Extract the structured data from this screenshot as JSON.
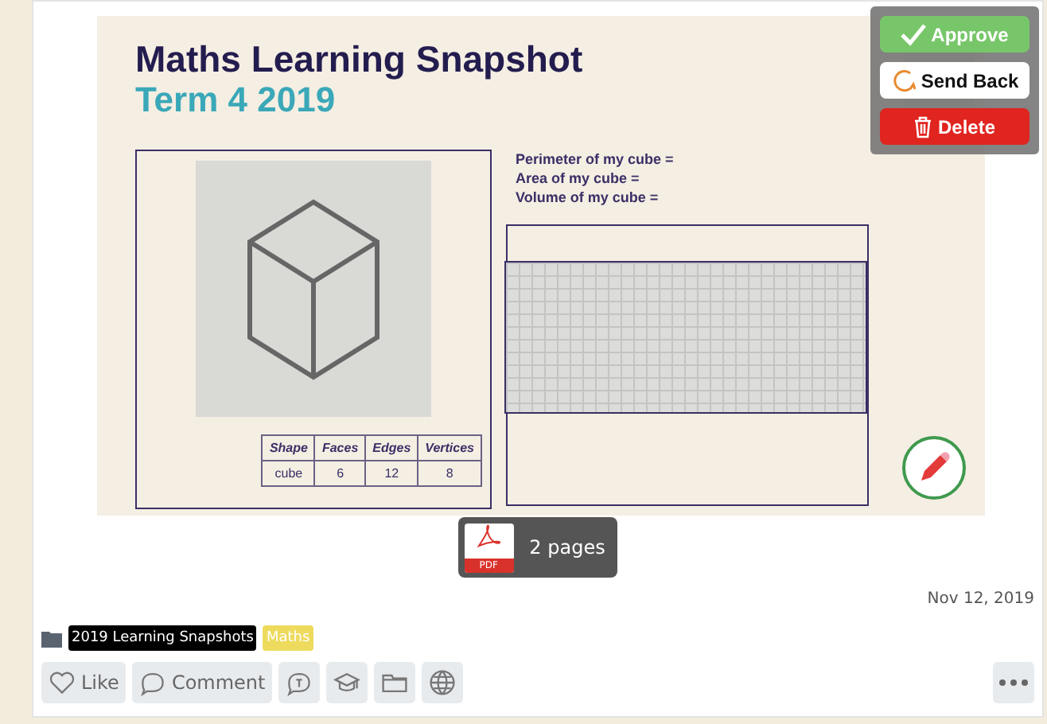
{
  "snapshot": {
    "title": "Maths Learning Snapshot",
    "subtitle": "Term 4 2019",
    "questions": [
      "Perimeter of my cube =",
      "Area of my cube =",
      "Volume of my cube ="
    ],
    "table": {
      "columns": [
        "Shape",
        "Faces",
        "Edges",
        "Vertices"
      ],
      "rows": [
        [
          "cube",
          "6",
          "12",
          "8"
        ]
      ]
    }
  },
  "review_actions": [
    {
      "kind": "approve",
      "label": "Approve"
    },
    {
      "kind": "send_back",
      "label": "Send Back"
    },
    {
      "kind": "delete",
      "label": "Delete"
    }
  ],
  "attachment": {
    "type_label": "PDF",
    "label": "2 pages"
  },
  "date": "Nov 12, 2019",
  "tags": [
    {
      "label": "2019 Learning Snapshots",
      "color": "#000000"
    },
    {
      "label": "Maths",
      "color": "#eedb5e"
    }
  ],
  "actions": [
    {
      "kind": "like",
      "label": "Like"
    },
    {
      "kind": "comment",
      "label": "Comment"
    },
    {
      "kind": "teacher-comment"
    },
    {
      "kind": "learning"
    },
    {
      "kind": "folder"
    },
    {
      "kind": "public"
    }
  ]
}
